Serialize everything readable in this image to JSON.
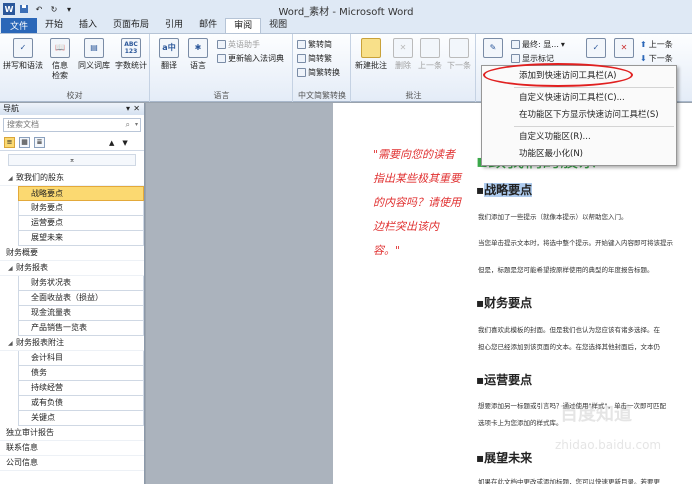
{
  "window": {
    "title": "Word_素材 - Microsoft Word"
  },
  "quick_access": {
    "icons": [
      "word-logo-icon",
      "save-icon",
      "undo-icon",
      "redo-icon",
      "customize-icon"
    ]
  },
  "tabs": {
    "file": "文件",
    "items": [
      "开始",
      "插入",
      "页面布局",
      "引用",
      "邮件",
      "审阅",
      "视图"
    ],
    "active": "审阅"
  },
  "ribbon": {
    "proofing": {
      "label": "校对",
      "spelling": "拼写和语法",
      "research": "信息\n检索",
      "thesaurus": "同义词库",
      "wordcount": "字数统计",
      "wordcount_icon_text": "ABC\n123"
    },
    "language": {
      "label": "语言",
      "translate": "翻译",
      "language": "语言",
      "english_assistant": "英语助手",
      "update_ime": "更新输入法词典"
    },
    "chinese_conversion": {
      "label": "中文简繁转换",
      "to_traditional": "繁转简",
      "simp": "简转繁",
      "convert": "简繁转换"
    },
    "comments": {
      "label": "批注",
      "new": "新建批注",
      "delete": "删除",
      "prev": "上一条",
      "next": "下一条"
    },
    "tracking": {
      "final_display": "最终: 显...",
      "show_markup": "显示标记"
    },
    "changes": {
      "prev": "上一条",
      "next": "下一条"
    }
  },
  "context_menu": {
    "items": [
      "添加到快速访问工具栏(A)",
      "自定义快速访问工具栏(C)...",
      "在功能区下方显示快速访问工具栏(S)",
      "自定义功能区(R)...",
      "功能区最小化(N)"
    ]
  },
  "nav_pane": {
    "title": "导航",
    "search_placeholder": "搜索文档",
    "items": [
      {
        "label": "致我们的股东",
        "level": 1,
        "expanded": true
      },
      {
        "label": "战略要点",
        "level": 2,
        "selected": true
      },
      {
        "label": "财务要点",
        "level": 2
      },
      {
        "label": "运营要点",
        "level": 2
      },
      {
        "label": "展望未来",
        "level": 2
      },
      {
        "label": "财务概要",
        "level": 0
      },
      {
        "label": "财务报表",
        "level": 1,
        "expanded": true
      },
      {
        "label": "财务状况表",
        "level": 2
      },
      {
        "label": "全面收益表（损益）",
        "level": 2
      },
      {
        "label": "现金流量表",
        "level": 2
      },
      {
        "label": "产品销售一览表",
        "level": 2
      },
      {
        "label": "财务报表附注",
        "level": 1,
        "expanded": true
      },
      {
        "label": "会计科目",
        "level": 2
      },
      {
        "label": "债务",
        "level": 2
      },
      {
        "label": "持续经营",
        "level": 2
      },
      {
        "label": "或有负债",
        "level": 2
      },
      {
        "label": "关键点",
        "level": 2
      },
      {
        "label": "独立审计报告",
        "level": 0
      },
      {
        "label": "联系信息",
        "level": 0
      },
      {
        "label": "公司信息",
        "level": 0
      }
    ]
  },
  "document": {
    "balloon_text": "\"需要向您的读者指出某些极其重要的内容吗？请使用边栏突出该内容。\"",
    "heading_big": "致我们的股东",
    "h_strategy": "战略要点",
    "p1": "我们添加了一些提示（就像本提示）以帮助您入门。",
    "p2": "当您单击提示文本时，将选中整个提示。开始键入内容即可将该提示",
    "p3": "但是，标题是您可能希望按原样使用的典型的年度报告标题。",
    "h_finance": "财务要点",
    "p4": "我们喜欢此模板的封面。但是我们也认为您应该有诸多选择。在",
    "p5": "担心您已经添加到该页面的文本。在您选择其他封面后，文本仍",
    "h_ops": "运营要点",
    "p6": "想要添加另一标题或引言吗？通过使用\"样式\"，单击一次即可匹配",
    "p7": "选项卡上为您添加的样式库。",
    "h_future": "展望未来",
    "p8": "如果在此文档中更改或添加标题，您可以快速更新目录。若要更"
  },
  "watermark": {
    "line1": "百度知道",
    "line2": "zhidao.baidu.com"
  }
}
